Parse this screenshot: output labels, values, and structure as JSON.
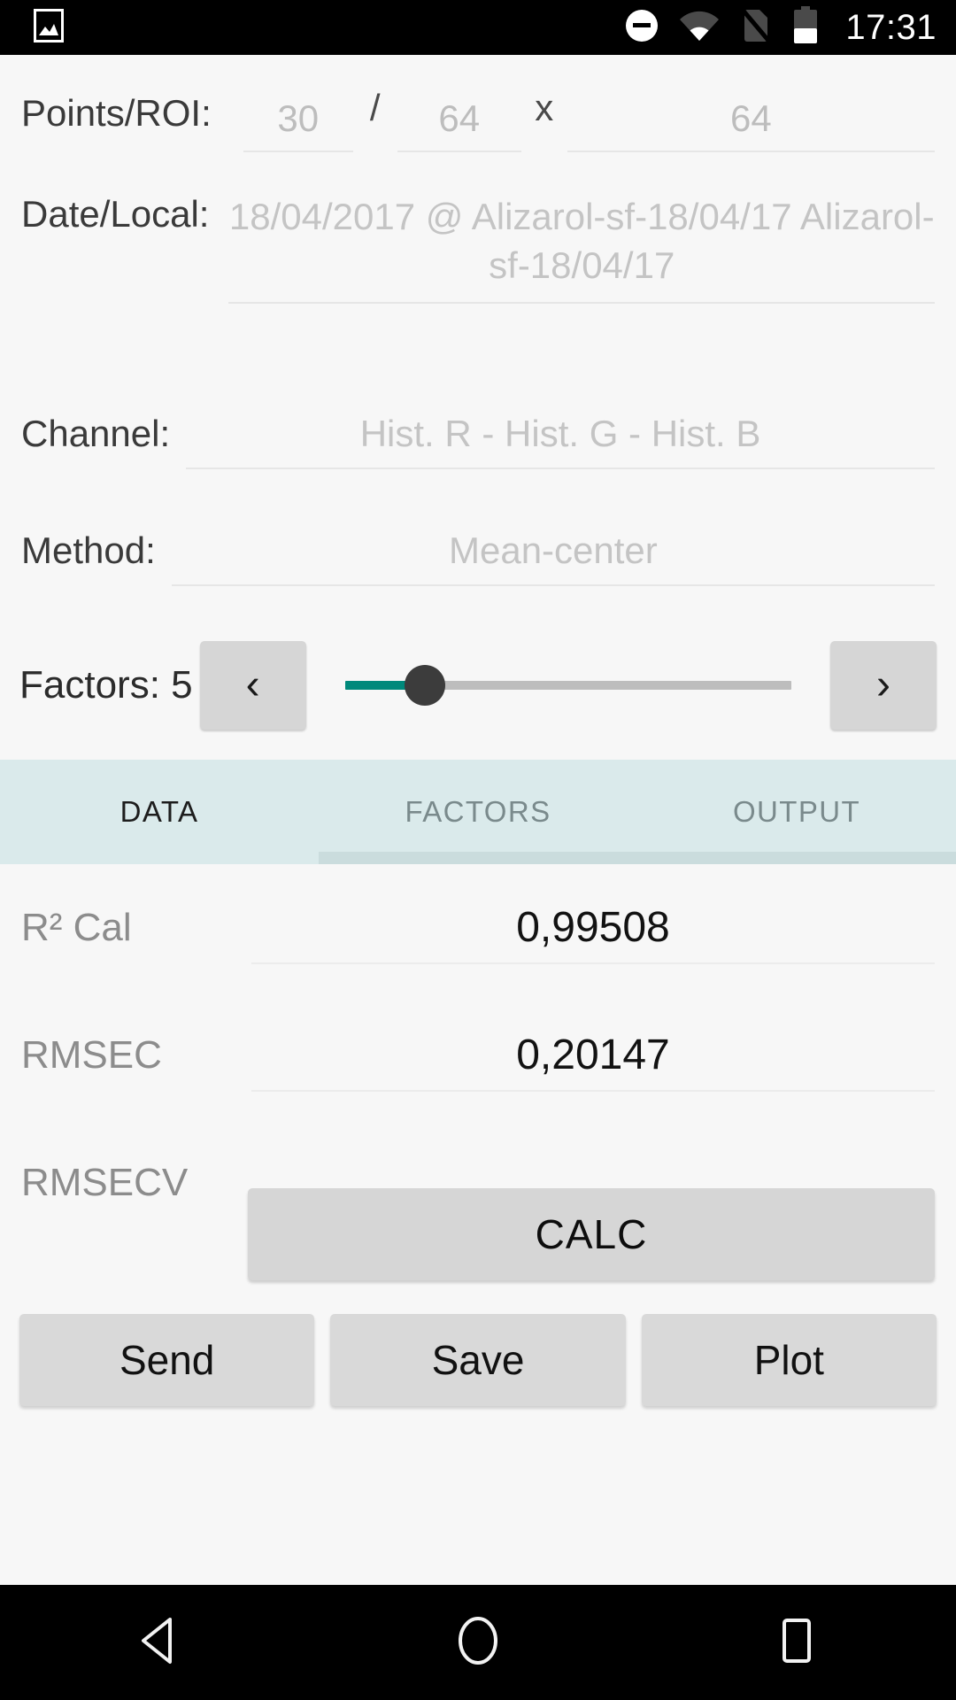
{
  "status_bar": {
    "time": "17:31",
    "icons": {
      "gallery": "image-icon",
      "dnd": "do-not-disturb-icon",
      "wifi": "wifi-icon",
      "sim": "no-sim-icon",
      "battery": "battery-half-icon"
    },
    "battery_level_percent": 50,
    "background_color": "#000000"
  },
  "form": {
    "points": {
      "label": "Points/ROI:",
      "points_value": "30",
      "separator": "/",
      "roi_width": "64",
      "multiply": "x",
      "roi_height": "64"
    },
    "date": {
      "label": "Date/Local:",
      "value": "18/04/2017 @ Alizarol-sf-18/04/17 Alizarol-sf-18/04/17"
    },
    "channel": {
      "label": "Channel:",
      "value": "Hist. R - Hist. G - Hist. B"
    },
    "method": {
      "label": "Method:",
      "value": "Mean-center"
    }
  },
  "factors": {
    "label": "Factors: 5",
    "value": 5,
    "prev_icon": "chevron-left",
    "next_icon": "chevron-right",
    "slider_percent": 18,
    "fill_color": "#00897b",
    "thumb_color": "#3c3c3c",
    "track_color": "#bdbdbd"
  },
  "tabs": {
    "background_color": "#daeaeb",
    "items": [
      {
        "label": "DATA",
        "active": true
      },
      {
        "label": "FACTORS",
        "active": false
      },
      {
        "label": "OUTPUT",
        "active": false
      }
    ]
  },
  "results": {
    "rows": [
      {
        "label": "R² Cal",
        "value": "0,99508"
      },
      {
        "label": "RMSEC",
        "value": "0,20147"
      },
      {
        "label": "RMSECV",
        "value": ""
      }
    ],
    "calc_button": "CALC",
    "actions": [
      "Send",
      "Save",
      "Plot"
    ]
  },
  "nav_bar": {
    "back": "back-triangle-icon",
    "home": "home-circle-icon",
    "recents": "recents-square-icon",
    "background_color": "#000000"
  }
}
